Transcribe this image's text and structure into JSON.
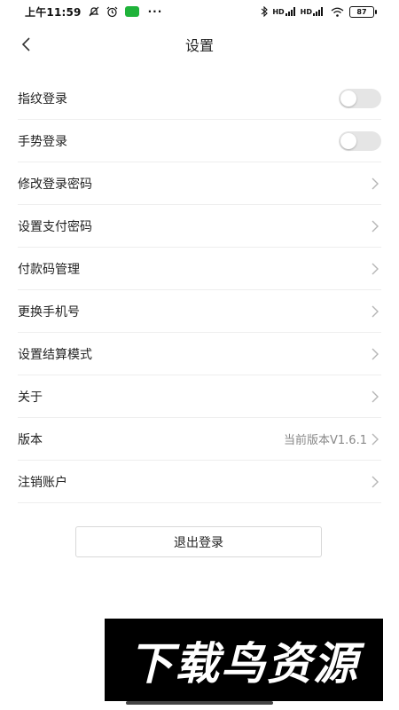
{
  "status_bar": {
    "time": "上午11:59",
    "dots": "···",
    "net1": "HD",
    "net2": "HD",
    "battery": "87"
  },
  "header": {
    "title": "设置"
  },
  "settings": {
    "items": [
      {
        "label": "指纹登录",
        "control": "toggle",
        "on": false
      },
      {
        "label": "手势登录",
        "control": "toggle",
        "on": false
      },
      {
        "label": "修改登录密码",
        "control": "chevron"
      },
      {
        "label": "设置支付密码",
        "control": "chevron"
      },
      {
        "label": "付款码管理",
        "control": "chevron"
      },
      {
        "label": "更换手机号",
        "control": "chevron"
      },
      {
        "label": "设置结算模式",
        "control": "chevron"
      },
      {
        "label": "关于",
        "control": "chevron"
      },
      {
        "label": "版本",
        "control": "chevron",
        "value": "当前版本V1.6.1"
      },
      {
        "label": "注销账户",
        "control": "chevron"
      }
    ]
  },
  "logout": {
    "label": "退出登录"
  },
  "watermark": {
    "text": "下载鸟资源"
  },
  "colors": {
    "toggle_off": "#e5e5e5",
    "divider": "#eeeeee",
    "wechat_green": "#1fb33a"
  }
}
